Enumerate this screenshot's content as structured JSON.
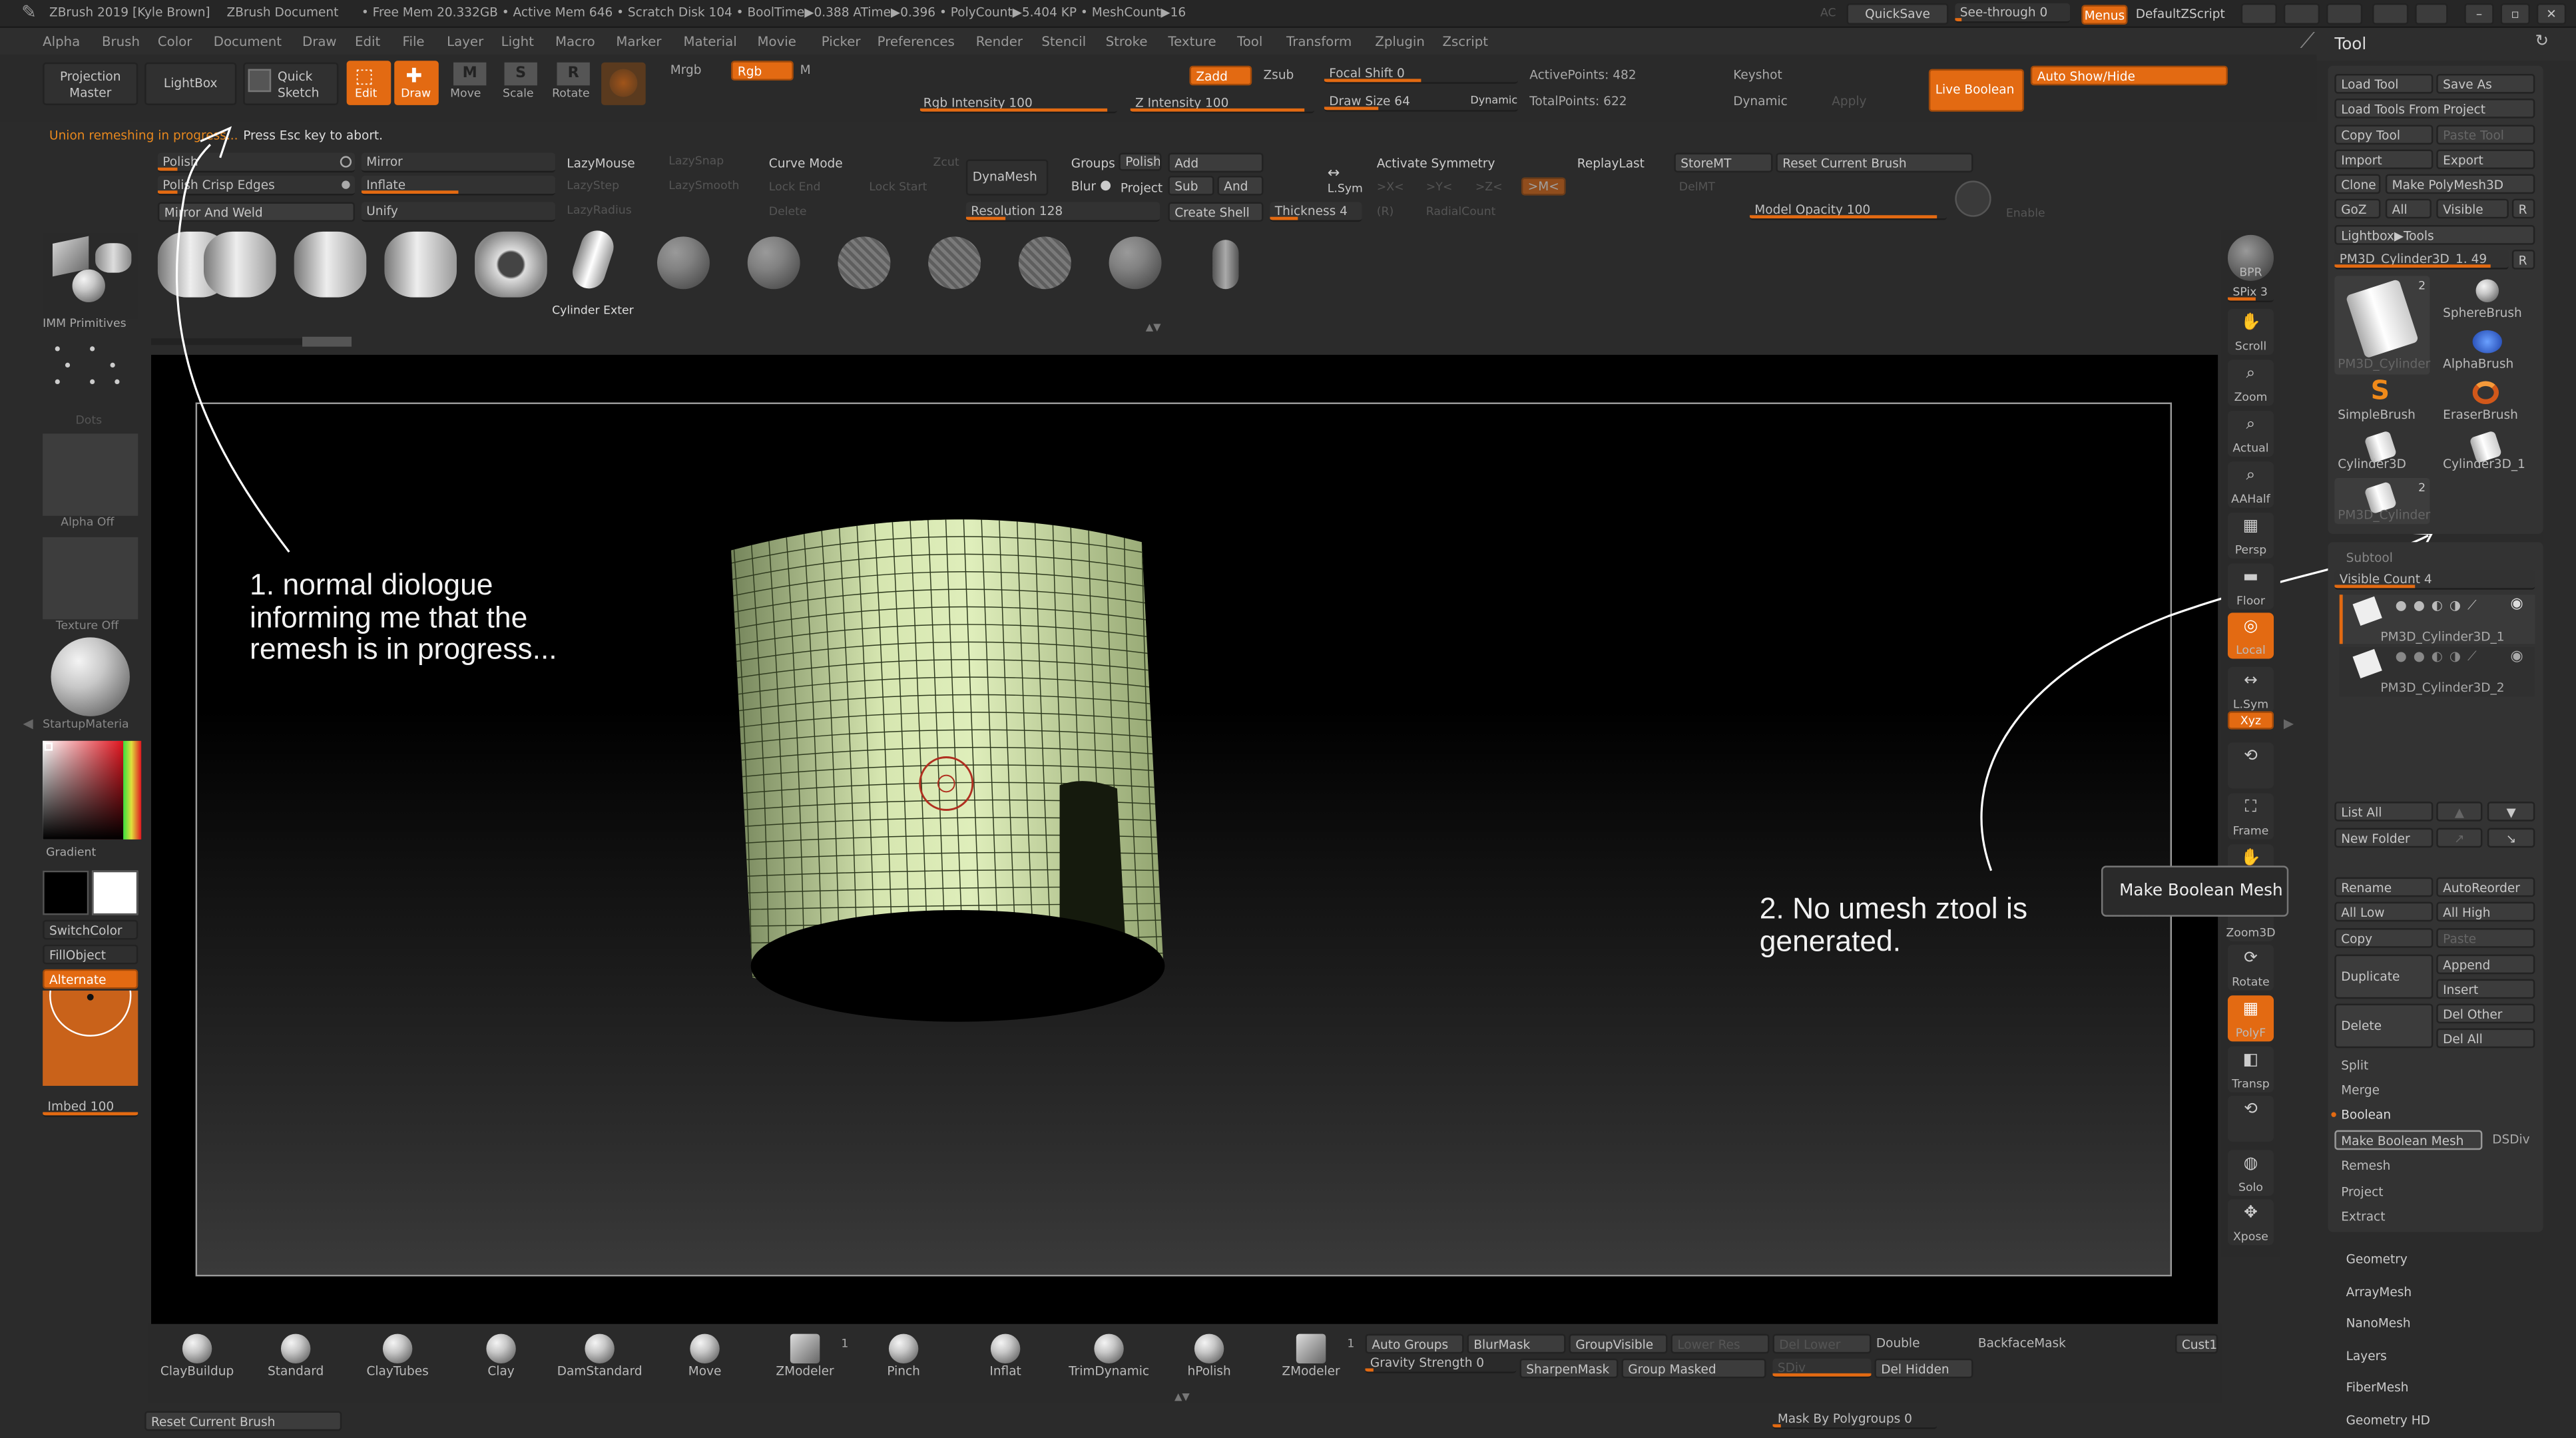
{
  "titlebar": {
    "app": "ZBrush 2019 [Kyle Brown]",
    "doc": "ZBrush Document",
    "stats": "• Free Mem 20.332GB • Active Mem 646 • Scratch Disk 104 • BoolTime▶0.388 ATime▶0.396 • PolyCount▶5.404 KP • MeshCount▶16",
    "ac": "AC",
    "quicksave": "QuickSave",
    "seethrough": "See-through  0",
    "menus": "Menus",
    "zscript": "DefaultZScript"
  },
  "menubar": [
    "Alpha",
    "Brush",
    "Color",
    "Document",
    "Draw",
    "Edit",
    "File",
    "Layer",
    "Light",
    "Macro",
    "Marker",
    "Material",
    "Movie",
    "Picker",
    "Preferences",
    "Render",
    "Stencil",
    "Stroke",
    "Texture",
    "Tool",
    "Transform",
    "Zplugin",
    "Zscript"
  ],
  "toolbar": {
    "projection_master": "Projection\nMaster",
    "lightbox": "LightBox",
    "quick_sketch": "Quick\nSketch",
    "edit": "Edit",
    "draw": "Draw",
    "move": "Move",
    "scale": "Scale",
    "rotate": "Rotate",
    "mrgb": "Mrgb",
    "rgb": "Rgb",
    "m": "M",
    "rgb_intensity": "Rgb Intensity 100",
    "zadd": "Zadd",
    "zsub": "Zsub",
    "z_intensity": "Z Intensity 100",
    "focal_shift": "Focal Shift 0",
    "draw_size": "Draw Size 64",
    "dynamic": "Dynamic",
    "active_points": "ActivePoints: 482",
    "total_points": "TotalPoints: 622",
    "keyshot": "Keyshot",
    "dynamic2": "Dynamic",
    "apply": "Apply",
    "live_boolean": "Live Boolean",
    "auto_show_hide": "Auto Show/Hide"
  },
  "status": {
    "progress": "Union remeshing in progress...",
    "hint": " Press Esc key to abort."
  },
  "row2": {
    "polish": "Polish",
    "polish_crisp": "Polish Crisp Edges",
    "mirror_weld": "Mirror And Weld",
    "mirror": "Mirror",
    "inflate": "Inflate",
    "unify": "Unify",
    "lazymouse": "LazyMouse",
    "lazysnap": "LazySnap",
    "lazystep": "LazyStep",
    "lazysmooth": "LazySmooth",
    "lazyradius": "LazyRadius",
    "curve_mode": "Curve Mode",
    "lock_end": "Lock End",
    "lock_start": "Lock Start",
    "delete": "Delete",
    "zcut": "Zcut",
    "dynamesh": "DynaMesh",
    "groups": "Groups",
    "polish2": "Polish",
    "blur": "Blur",
    "project": "Project",
    "resolution": "Resolution 128",
    "add": "Add",
    "sub": "Sub",
    "and": "And",
    "create_shell": "Create Shell",
    "thickness": "Thickness 4",
    "lsym": "L.Sym",
    "activate_sym": "Activate Symmetry",
    "x": ">X<",
    "y": ">Y<",
    "z": ">Z<",
    "m": ">M<",
    "r": "(R)",
    "radialcount": "RadialCount",
    "replaylast": "ReplayLast",
    "storemt": "StoreMT",
    "delmt": "DelMT",
    "reset_brush": "Reset Current Brush",
    "model_opacity": "Model Opacity 100",
    "enable": "Enable"
  },
  "shelf": {
    "items": [
      "Brush 1",
      "Brush 2",
      "Brush 3",
      "Brush 4",
      "Brush 5",
      "Cylinder Exter",
      "Sphere 1",
      "Sphere 2",
      "Sphere 3",
      "Sphere 4",
      "Sphere 5",
      "Sphere 6",
      "Capsule"
    ],
    "selected_label": "Cylinder Exter"
  },
  "leftpanel": {
    "imm": "IMM Primitives",
    "dots": "Dots",
    "alpha": "Alpha Off",
    "texture": "Texture Off",
    "material": "StartupMateria",
    "gradient": "Gradient",
    "switchcolor": "SwitchColor",
    "fillobject": "FillObject",
    "alternate": "Alternate",
    "imbed": "Imbed 100"
  },
  "rightnav": [
    "BPR",
    "SPix 3",
    "Scroll",
    "Zoom",
    "Actual",
    "AAHalf",
    "Persp",
    "Floor",
    "Local",
    "L.Sym",
    "Xyz",
    "",
    "Frame",
    "Move",
    "Zoom3D",
    "Rotate",
    "PolyF",
    "Transp",
    "",
    "Solo",
    "Xpose"
  ],
  "toolpanel": {
    "title": "Tool",
    "load_tool": "Load Tool",
    "save_as": "Save As",
    "load_from_project": "Load Tools From Project",
    "copy_tool": "Copy Tool",
    "paste_tool": "Paste Tool",
    "import": "Import",
    "export": "Export",
    "clone": "Clone",
    "make_polymesh": "Make PolyMesh3D",
    "goz": "GoZ",
    "all": "All",
    "visible": "Visible",
    "r": "R",
    "lightbox_tools": "Lightbox▶Tools",
    "current": "PM3D_Cylinder3D_1. 49",
    "tools": [
      {
        "label": "PM3D_Cylinder",
        "badge": "2"
      },
      {
        "label": "SphereBrush",
        "badge": ""
      },
      {
        "label": "AlphaBrush",
        "badge": ""
      },
      {
        "label": "SimpleBrush",
        "badge": ""
      },
      {
        "label": "EraserBrush",
        "badge": ""
      },
      {
        "label": "Cylinder3D",
        "badge": ""
      },
      {
        "label": "Cylinder3D_1",
        "badge": ""
      },
      {
        "label": "PM3D_Cylinder",
        "badge": "2"
      }
    ],
    "subtool": "Subtool",
    "visible_count": "Visible Count 4",
    "subtools": [
      "PM3D_Cylinder3D_1",
      "PM3D_Cylinder3D_2"
    ],
    "list_all": "List All",
    "new_folder": "New Folder",
    "tooltip": "Make Boolean Mesh",
    "rename": "Rename",
    "autoreorder": "AutoReorder",
    "all_low": "All Low",
    "all_high": "All High",
    "copy": "Copy",
    "paste": "Paste",
    "duplicate": "Duplicate",
    "append": "Append",
    "insert": "Insert",
    "delete": "Delete",
    "del_other": "Del Other",
    "del_all": "Del All",
    "split": "Split",
    "merge": "Merge",
    "boolean": "Boolean",
    "make_boolean_mesh": "Make Boolean Mesh",
    "dsdiv": "DSDiv",
    "remesh": "Remesh",
    "project": "Project",
    "extract": "Extract",
    "sections": [
      "Geometry",
      "ArrayMesh",
      "NanoMesh",
      "Layers",
      "FiberMesh",
      "Geometry HD"
    ]
  },
  "bottom": {
    "brushes": [
      "ClayBuildup",
      "Standard",
      "ClayTubes",
      "Clay",
      "DamStandard",
      "Move",
      "ZModeler",
      "Pinch",
      "Inflat",
      "TrimDynamic",
      "hPolish",
      "ZModeler"
    ],
    "badge1": "1",
    "badge2": "1",
    "auto_groups": "Auto Groups",
    "blurmask": "BlurMask",
    "groupvisible": "GroupVisible",
    "lower_res": "Lower Res",
    "del_lower": "Del Lower",
    "double": "Double",
    "backfacemask": "BackfaceMask",
    "cust1": "Cust1",
    "gravity": "Gravity Strength 0",
    "sharpenmask": "SharpenMask",
    "group_masked": "Group Masked",
    "sdiv": "SDiv",
    "del_hidden": "Del Hidden",
    "reset": "Reset Current Brush",
    "mask_polygroups": "Mask By Polygroups 0"
  },
  "annotations": {
    "note1": "1. normal diologue\ninforming me that the\nremesh is in progress...",
    "note2": "2. No umesh ztool is\ngenerated."
  },
  "colors": {
    "accent": "#e36a12",
    "bg": "#2b2b2b",
    "viewport": "#000000",
    "mesh": "#c9d9a4"
  }
}
